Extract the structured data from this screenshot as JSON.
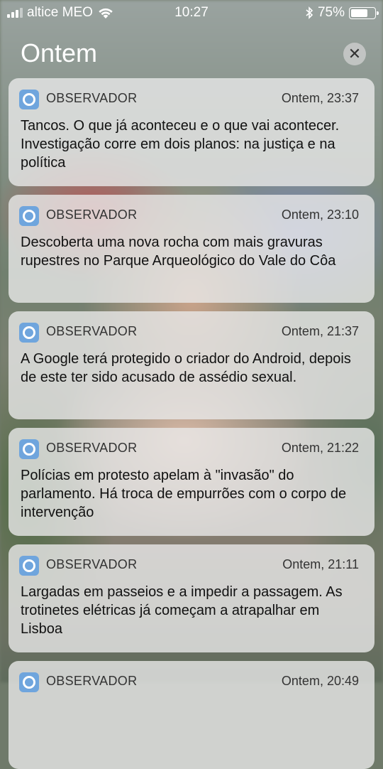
{
  "status_bar": {
    "carrier": "altice MEO",
    "time": "10:27",
    "battery_percent": "75%",
    "battery_level": 0.75,
    "icons": [
      "signal-icon",
      "wifi-icon",
      "bluetooth-icon",
      "battery-icon"
    ]
  },
  "header": {
    "title": "Ontem",
    "close_glyph": "✕"
  },
  "notifications": [
    {
      "app": "OBSERVADOR",
      "time": "Ontem, 23:37",
      "text": "Tancos. O que já aconteceu e o que vai acontecer. Investigação corre em dois planos: na justiça e na política"
    },
    {
      "app": "OBSERVADOR",
      "time": "Ontem, 23:10",
      "text": "Descoberta uma nova rocha com mais gravuras rupestres no Parque Arqueológico do Vale do Côa"
    },
    {
      "app": "OBSERVADOR",
      "time": "Ontem, 21:37",
      "text": "A Google terá protegido o criador do Android, depois de este ter sido acusado de assédio sexual."
    },
    {
      "app": "OBSERVADOR",
      "time": "Ontem, 21:22",
      "text": "Polícias em protesto apelam à \"invasão\" do parlamento. Há troca de empurrões com o corpo de intervenção"
    },
    {
      "app": "OBSERVADOR",
      "time": "Ontem, 21:11",
      "text": "Largadas em passeios e a impedir a passagem. As trotinetes elétricas já começam a atrapalhar em Lisboa"
    },
    {
      "app": "OBSERVADOR",
      "time": "Ontem, 20:49",
      "text": ""
    }
  ],
  "colors": {
    "app_icon": "#6fa5dd",
    "card_bg": "rgba(232,232,232,0.80)"
  }
}
